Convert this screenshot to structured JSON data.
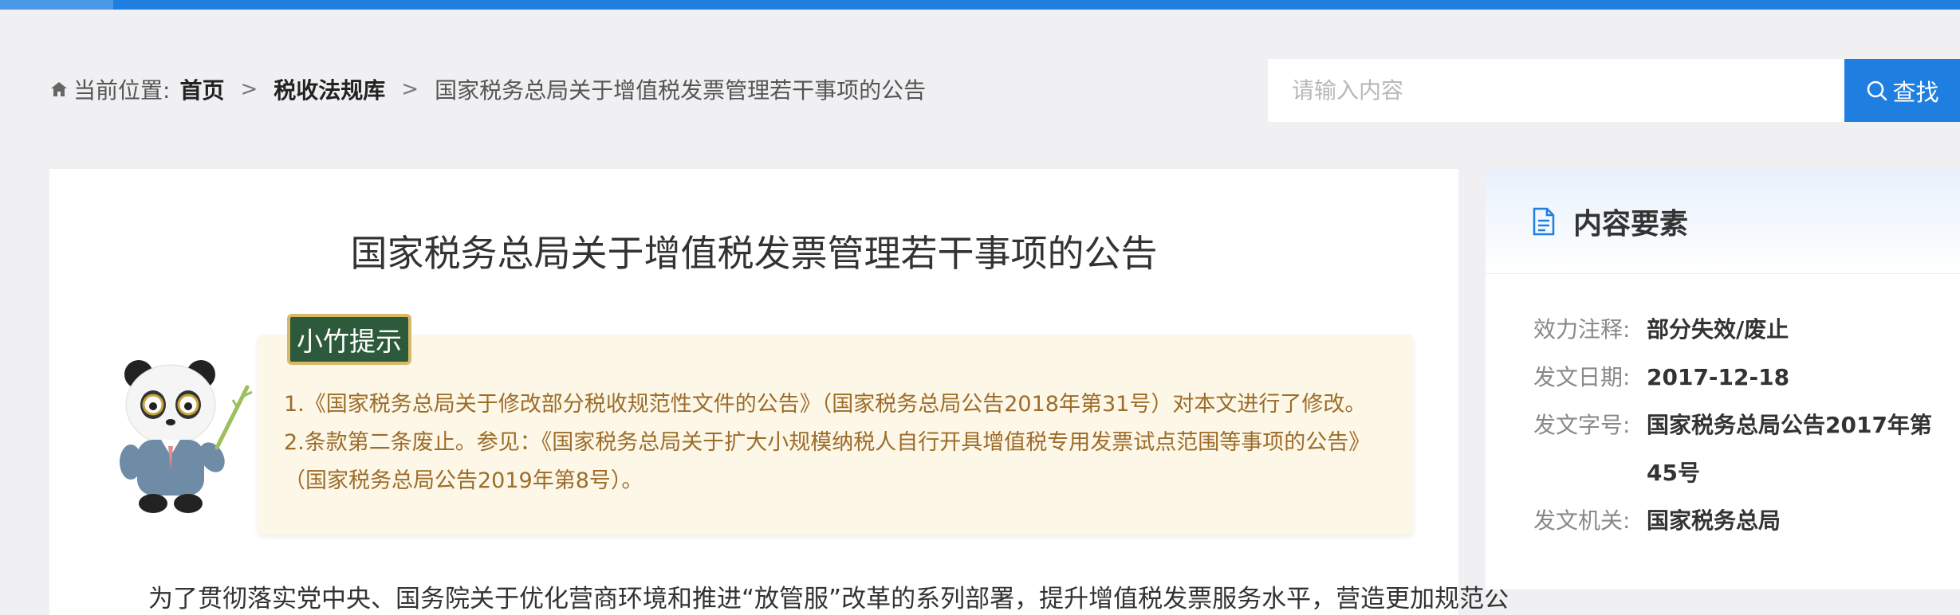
{
  "breadcrumb": {
    "prefix": "当前位置:",
    "home": "首页",
    "category": "税收法规库",
    "current": "国家税务总局关于增值税发票管理若干事项的公告",
    "separator": ">"
  },
  "search": {
    "placeholder": "请输入内容",
    "button_label": "查找"
  },
  "document": {
    "title": "国家税务总局关于增值税发票管理若干事项的公告",
    "tip_badge": "小竹提示",
    "tip_text": "1.《国家税务总局关于修改部分税收规范性文件的公告》（国家税务总局公告2018年第31号）对本文进行了修改。 2.条款第二条废止。参见：《国家税务总局关于扩大小规模纳税人自行开具增值税专用发票试点范围等事项的公告》（国家税务总局公告2019年第8号）。",
    "body_first_line": "为了贯彻落实党中央、国务院关于优化营商环境和推进“放管服”改革的系列部署，提升增值税发票服务水平，营造更加规范公"
  },
  "side_panel": {
    "title": "内容要素",
    "items": [
      {
        "label": "效力注释:",
        "value": "部分失效/废止"
      },
      {
        "label": "发文日期:",
        "value": "2017-12-18"
      },
      {
        "label": "发文字号:",
        "value": "国家税务总局公告2017年第45号"
      },
      {
        "label": "发文机关:",
        "value": "国家税务总局"
      }
    ]
  },
  "colors": {
    "accent": "#1e7fe0",
    "tip_text": "#9c6c2a",
    "tip_bg": "#fdf7e7",
    "badge_bg": "#2e5a3c"
  },
  "icons": {
    "home": "home-icon",
    "search": "search-icon",
    "document": "document-icon",
    "mascot": "panda-mascot"
  }
}
